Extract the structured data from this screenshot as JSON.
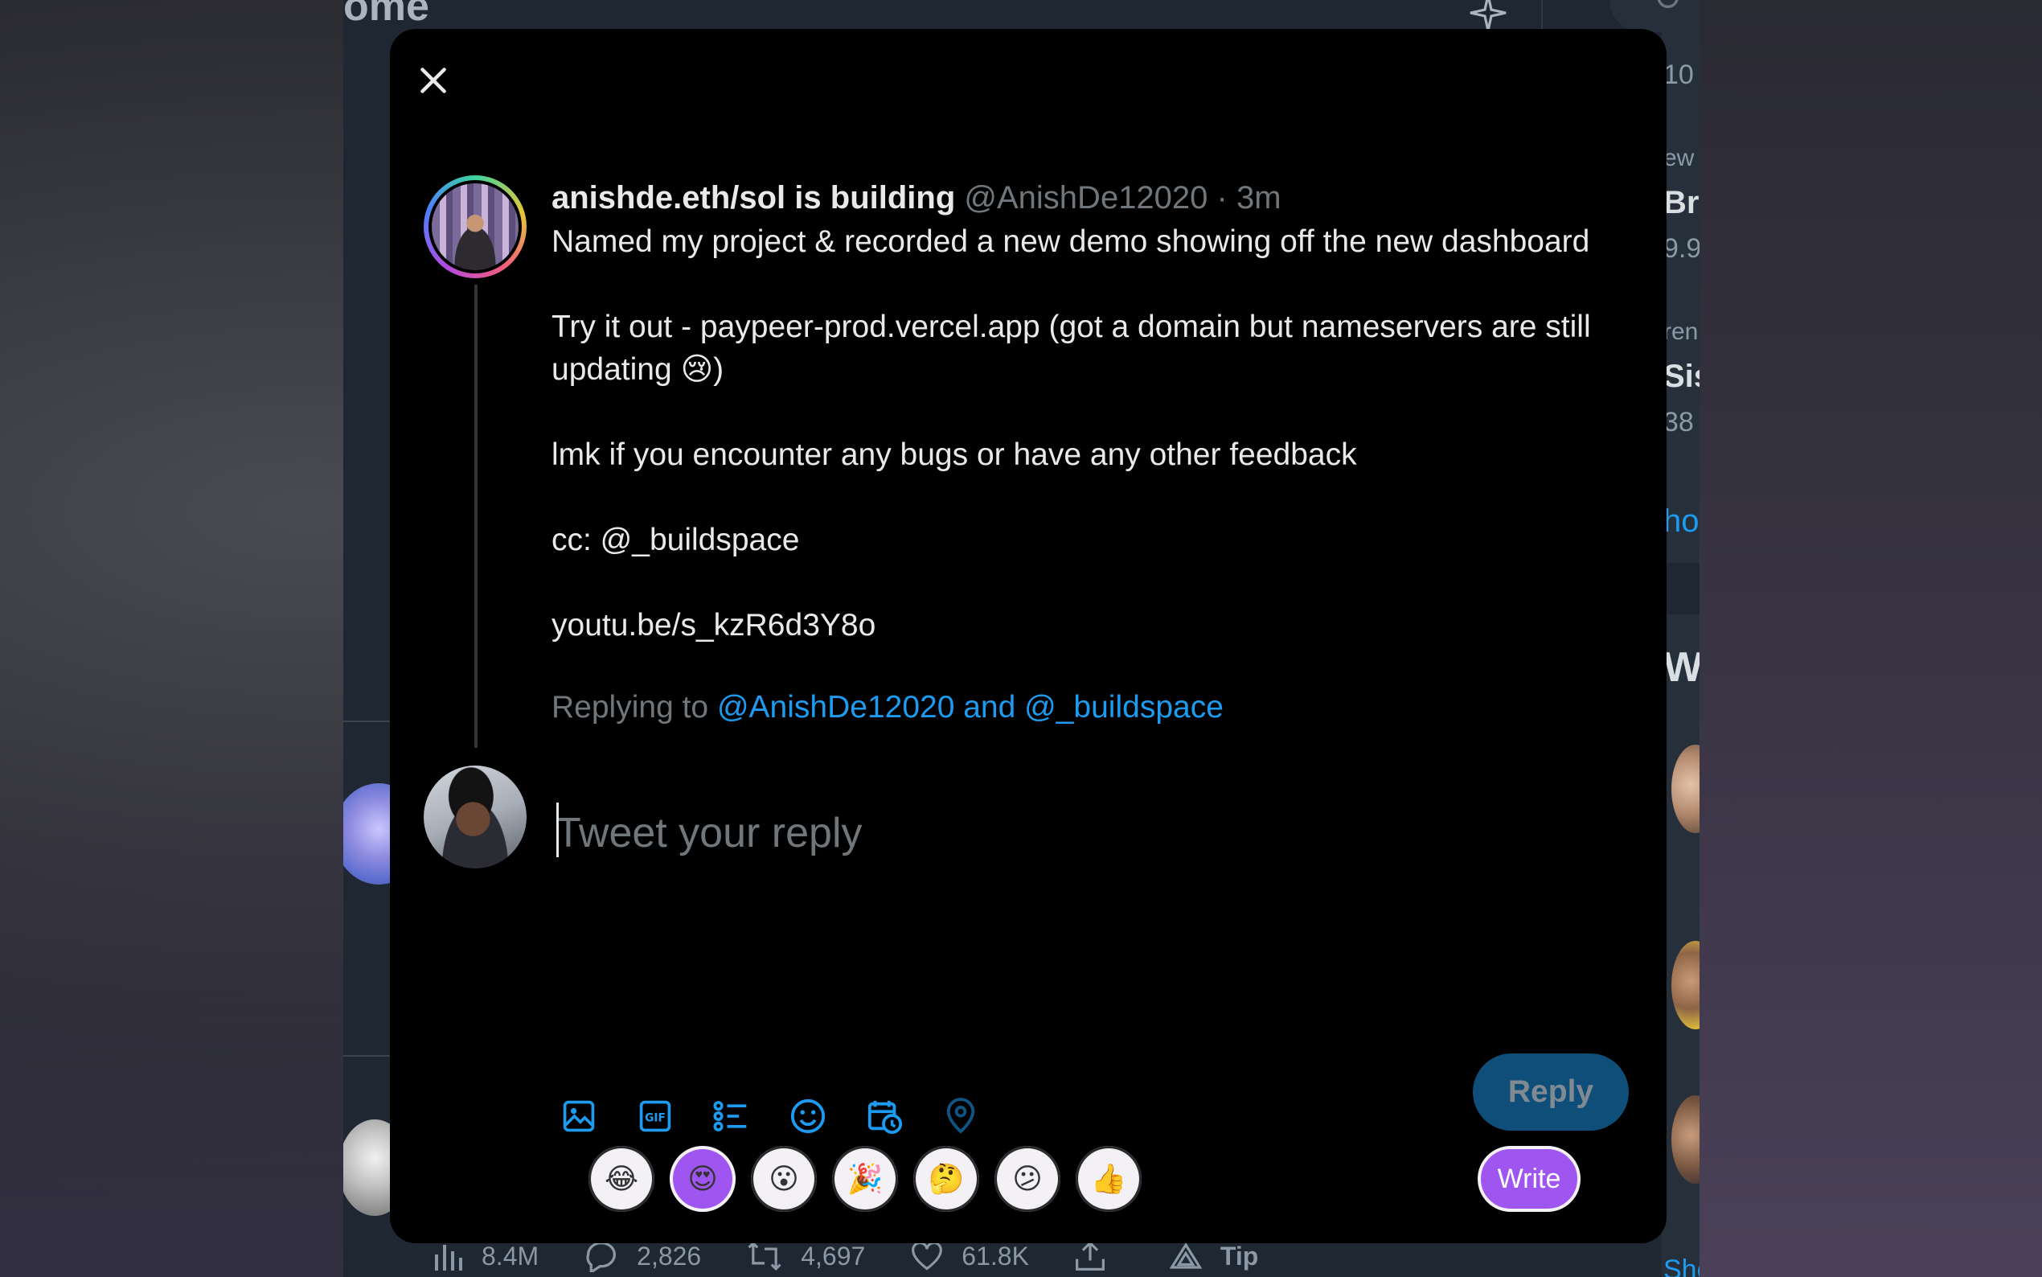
{
  "background_app": {
    "home_title": "ome",
    "right_column": {
      "snippets": [
        "10",
        "ew",
        "Br",
        "9.9",
        "ren",
        "Sis",
        "38",
        "ho",
        "Wh",
        "Sho"
      ]
    },
    "stats": {
      "views": "8.4M",
      "replies": "2,826",
      "retweets": "4,697",
      "likes": "61.8K",
      "tip_label": "Tip"
    }
  },
  "modal": {
    "original_tweet": {
      "display_name": "anishde.eth/sol is building",
      "handle": "@AnishDe12020",
      "separator": "·",
      "time": "3m",
      "lines": {
        "l1": "Named my project & recorded a new demo showing off the new dashboard",
        "l2": "Try it out - paypeer-prod.vercel.app (got a domain but nameservers are still",
        "l3a": "updating ",
        "l3_emoji": "😢",
        "l3b": ")",
        "l4": "lmk if you encounter any bugs or have any other feedback",
        "l5": "cc: @_buildspace",
        "l6": "youtu.be/s_kzR6d3Y8o"
      }
    },
    "replying_to": {
      "label": "Replying to ",
      "mentions": "@AnishDe12020 and @_buildspace"
    },
    "compose": {
      "placeholder": "Tweet your reply",
      "value": ""
    },
    "reply_button_label": "Reply",
    "reactions": [
      "😂",
      "😍",
      "😮",
      "🎉",
      "🤔",
      "😕",
      "👍"
    ],
    "write_button_label": "Write",
    "accent_color": "#1d9bf0",
    "extension_color": "#9f55f0"
  }
}
